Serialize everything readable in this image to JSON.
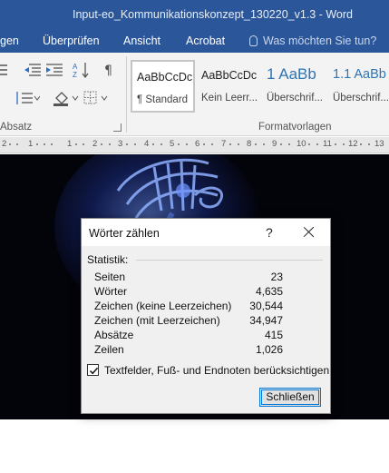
{
  "window": {
    "title": "Input-eo_Kommunikationskonzept_130220_v1.3  -  Word"
  },
  "ribbon_tabs": [
    {
      "label": "gen"
    },
    {
      "label": "Überprüfen"
    },
    {
      "label": "Ansicht"
    },
    {
      "label": "Acrobat"
    }
  ],
  "tell_me": {
    "placeholder": "Was möchten Sie tun?"
  },
  "ribbon": {
    "paragraph_group_label": "Absatz",
    "styles_group_label": "Formatvorlagen",
    "styles": [
      {
        "sample": "AaBbCcDc",
        "name": "¶ Standard"
      },
      {
        "sample": "AaBbCcDc",
        "name": "Kein Leerr..."
      },
      {
        "sample": "1  AaBb",
        "name": "Überschrif..."
      },
      {
        "sample": "1.1  AaBb",
        "name": "Überschrif..."
      }
    ]
  },
  "ruler": {
    "labels": [
      "2",
      "1",
      "1",
      "2",
      "3",
      "4",
      "5",
      "6",
      "7",
      "8",
      "9",
      "10",
      "11",
      "12",
      "13"
    ]
  },
  "dialog": {
    "title": "Wörter zählen",
    "help": "?",
    "statistics_label": "Statistik:",
    "rows": [
      {
        "label": "Seiten",
        "value": "23"
      },
      {
        "label": "Wörter",
        "value": "4,635"
      },
      {
        "label": "Zeichen (keine Leerzeichen)",
        "value": "30,544"
      },
      {
        "label": "Zeichen (mit Leerzeichen)",
        "value": "34,947"
      },
      {
        "label": "Absätze",
        "value": "415"
      },
      {
        "label": "Zeilen",
        "value": "1,026"
      }
    ],
    "checkbox": {
      "label": "Textfelder, Fuß- und Endnoten berücksichtigen",
      "checked": true
    },
    "close_button": "Schließen"
  },
  "colors": {
    "title_bar": "#2b579a",
    "ribbon": "#f3f3f3",
    "dialog": "#f0f0f0",
    "button_focus": "#0078d7"
  }
}
